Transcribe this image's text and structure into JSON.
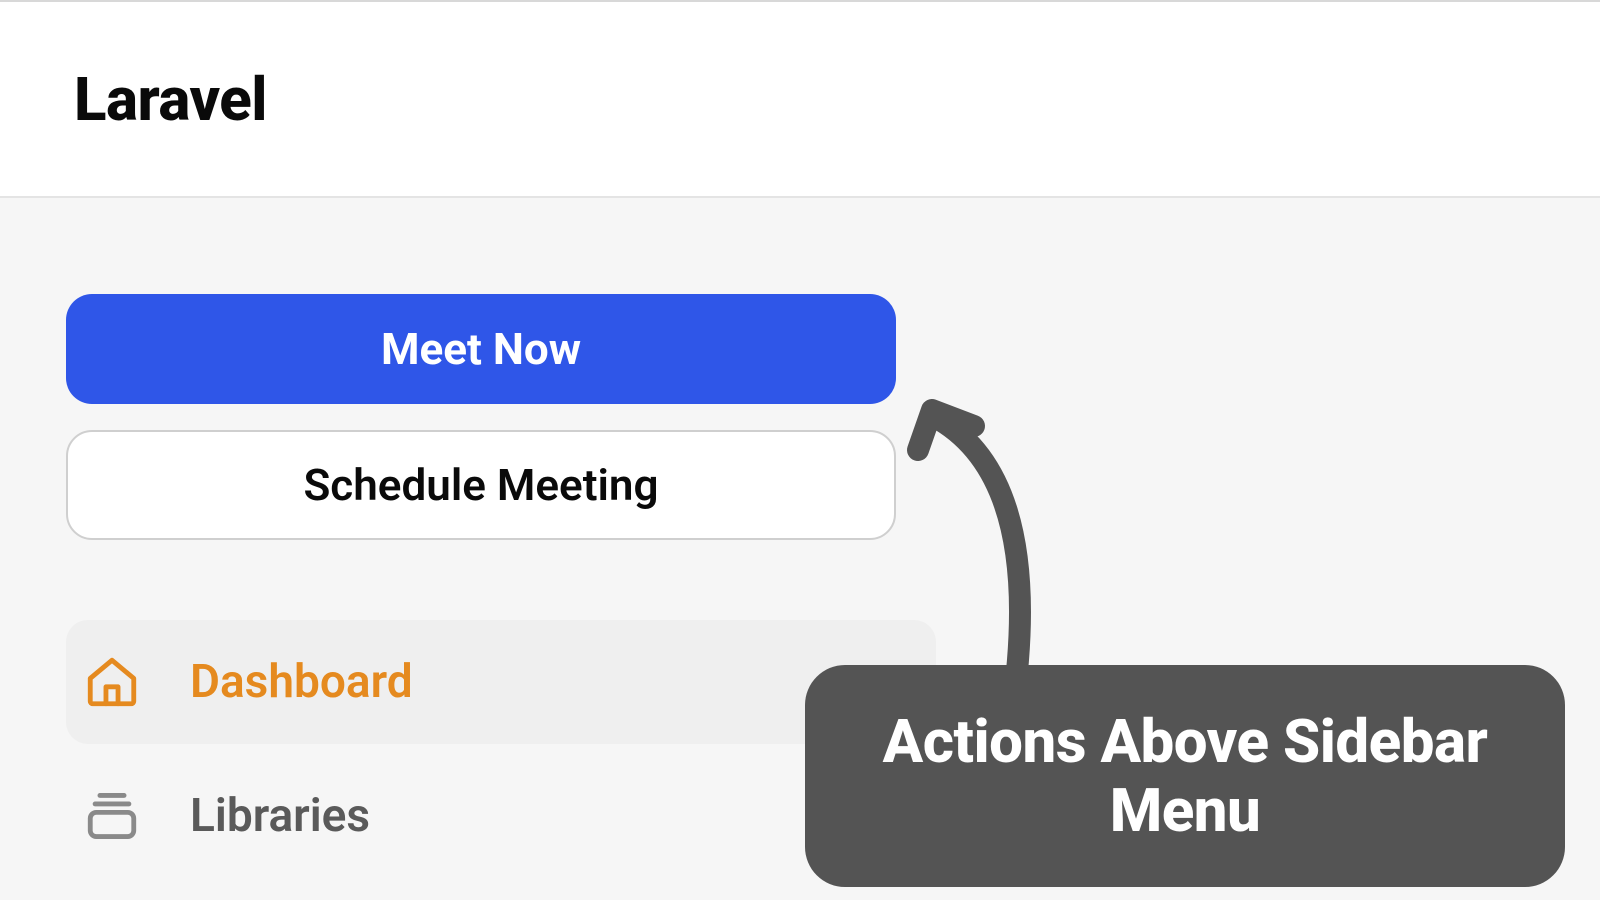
{
  "header": {
    "title": "Laravel"
  },
  "actions": {
    "primary_label": "Meet Now",
    "secondary_label": "Schedule Meeting"
  },
  "sidebar": {
    "items": [
      {
        "label": "Dashboard",
        "icon": "home-icon",
        "active": true
      },
      {
        "label": "Libraries",
        "icon": "stack-icon",
        "active": false
      }
    ]
  },
  "annotation": {
    "text": "Actions Above Sidebar Menu"
  },
  "colors": {
    "primary": "#2f56e8",
    "accent": "#e58a1f",
    "annotation_bg": "#545454"
  }
}
